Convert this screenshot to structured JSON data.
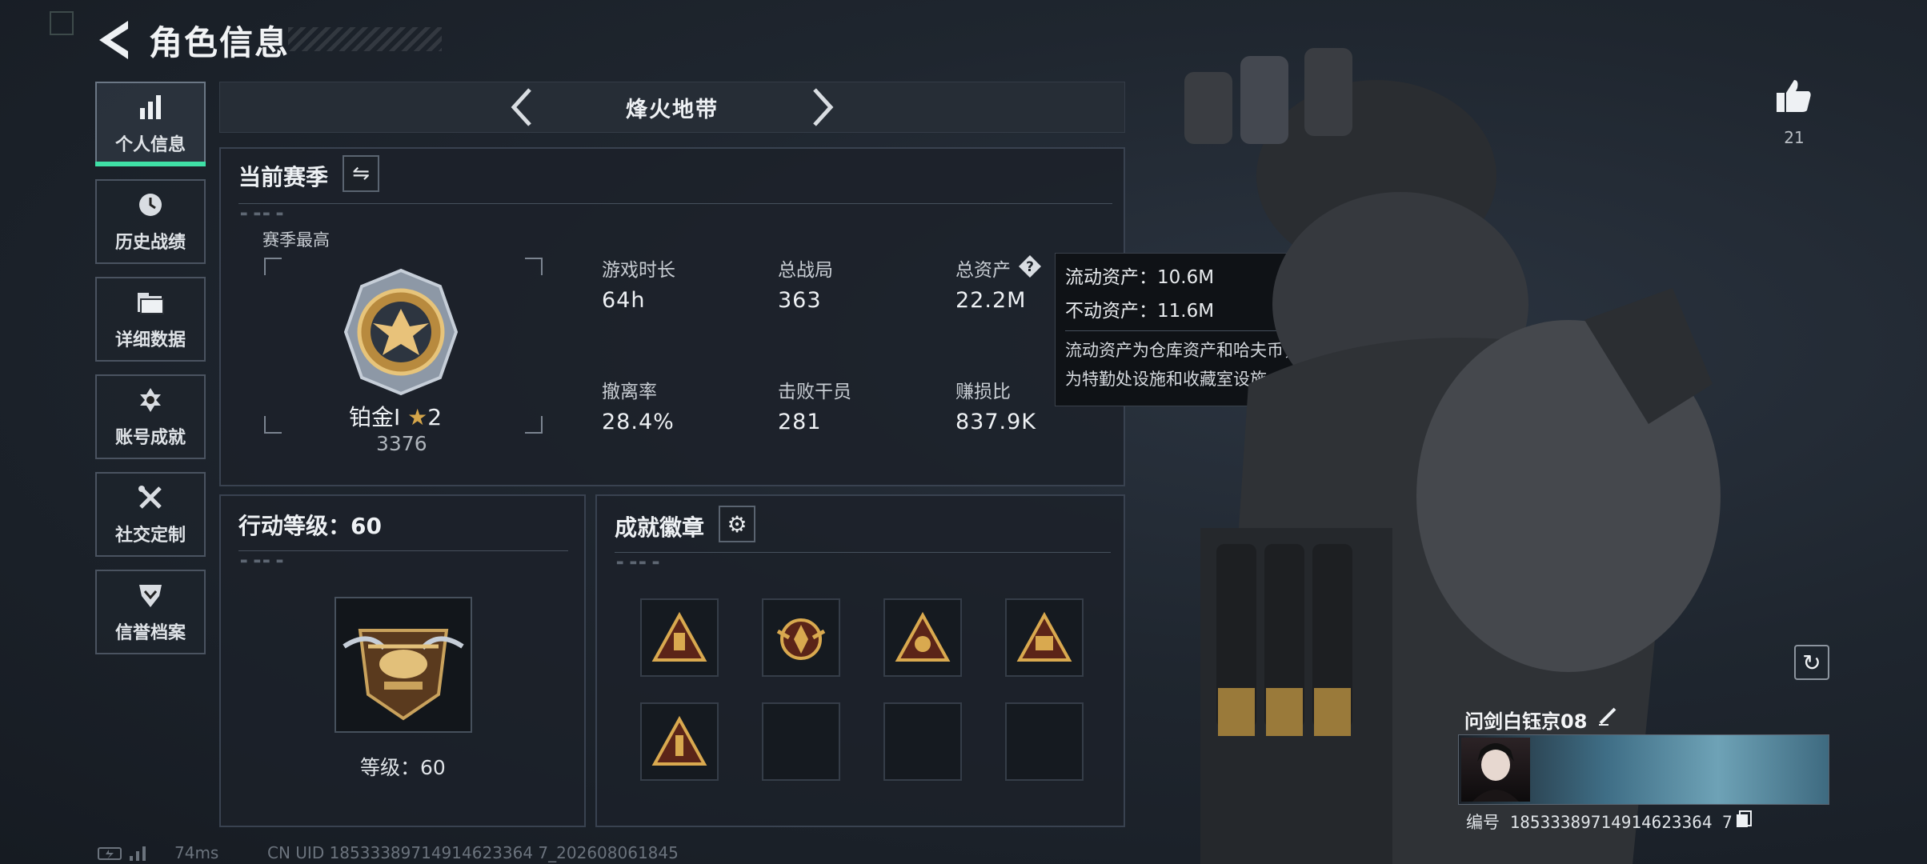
{
  "header": {
    "title": "角色信息"
  },
  "sidebar": {
    "items": [
      {
        "label": "个人信息",
        "icon": "bar-chart-icon"
      },
      {
        "label": "历史战绩",
        "icon": "clock-icon"
      },
      {
        "label": "详细数据",
        "icon": "folder-icon"
      },
      {
        "label": "账号成就",
        "icon": "achievement-icon"
      },
      {
        "label": "社交定制",
        "icon": "tools-icon"
      },
      {
        "label": "信誉档案",
        "icon": "shield-icon"
      }
    ]
  },
  "mode_tab": {
    "title": "烽火地带"
  },
  "season": {
    "title": "当前赛季",
    "best_label": "赛季最高",
    "rank_name": "铂金Ⅰ",
    "rank_stars": "2",
    "rank_score": "3376",
    "stats": [
      {
        "label": "游戏时长",
        "value": "64h"
      },
      {
        "label": "总战局",
        "value": "363"
      },
      {
        "label": "总资产",
        "value": "22.2M"
      },
      {
        "label": "撤离率",
        "value": "28.4%"
      },
      {
        "label": "击败干员",
        "value": "281"
      },
      {
        "label": "赚损比",
        "value": "837.9K"
      }
    ]
  },
  "tooltip": {
    "liquid": "流动资产：10.6M",
    "fixed": "不动资产：11.6M",
    "desc_line1": "流动资产为仓库资产和哈夫币，不动资产",
    "desc_line2": "为特勤处设施和收藏室设施"
  },
  "action_level": {
    "title": "行动等级：60",
    "level_text": "等级：60"
  },
  "achievements": {
    "title": "成就徽章",
    "slots": [
      "filled",
      "filled",
      "filled",
      "filled",
      "filled",
      "empty",
      "empty",
      "empty"
    ]
  },
  "likes": {
    "count": "21"
  },
  "profile": {
    "name": "问剑白钰京08",
    "id_line": "编号 18533389714914623364 7"
  },
  "footer": {
    "ping": "74ms",
    "uid": "CN UID 18533389714914623364 7_202608061845"
  },
  "colors": {
    "accent": "#3fe0a6",
    "panel_border": "#394250",
    "background": "#1f262f"
  }
}
